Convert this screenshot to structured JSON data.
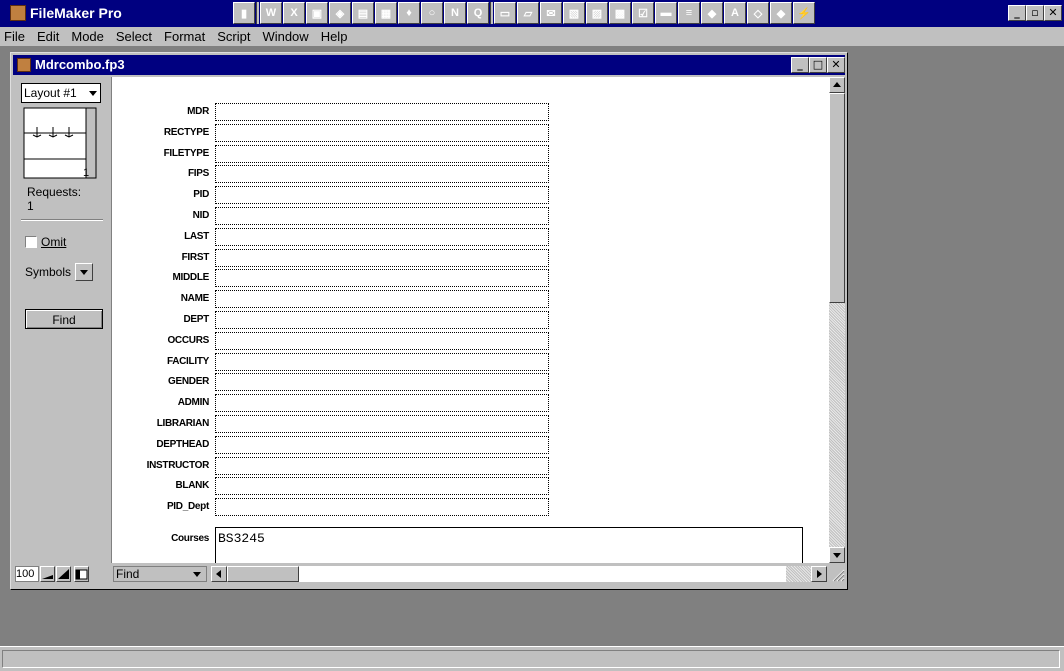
{
  "app": {
    "title": "FileMaker Pro",
    "caption_buttons": [
      "_",
      "▫",
      "✕"
    ]
  },
  "toolbar_tray": [
    {
      "icon": "app-launcher-icon",
      "glyph": "▮"
    },
    {
      "icon": "word-icon",
      "glyph": "W"
    },
    {
      "icon": "excel-icon",
      "glyph": "X"
    },
    {
      "icon": "powerpoint-icon",
      "glyph": "▣"
    },
    {
      "icon": "access-icon",
      "glyph": "◈"
    },
    {
      "icon": "schedule-icon",
      "glyph": "▤"
    },
    {
      "icon": "office-binder-icon",
      "glyph": "▦"
    },
    {
      "icon": "shortcut-bar-icon",
      "glyph": "♦"
    },
    {
      "icon": "circle-icon",
      "glyph": "○"
    },
    {
      "icon": "n-app-icon",
      "glyph": "N"
    },
    {
      "icon": "find-icon",
      "glyph": "Q"
    },
    {
      "icon": "new-document-icon",
      "glyph": "▭"
    },
    {
      "icon": "open-folder-icon",
      "glyph": "▱"
    },
    {
      "icon": "mail-icon",
      "glyph": "✉"
    },
    {
      "icon": "contacts-icon",
      "glyph": "▧"
    },
    {
      "icon": "task-icon",
      "glyph": "▨"
    },
    {
      "icon": "calendar-icon",
      "glyph": "▩"
    },
    {
      "icon": "checklist-icon",
      "glyph": "☑"
    },
    {
      "icon": "card-icon",
      "glyph": "▬"
    },
    {
      "icon": "keyboard-icon",
      "glyph": "≡"
    },
    {
      "icon": "graphics-icon",
      "glyph": "◆"
    },
    {
      "icon": "acrobat-icon",
      "glyph": "A"
    },
    {
      "icon": "paint-icon",
      "glyph": "◇"
    },
    {
      "icon": "gem-icon",
      "glyph": "◆"
    },
    {
      "icon": "wand-icon",
      "glyph": "⚡"
    }
  ],
  "menu": [
    "File",
    "Edit",
    "Mode",
    "Select",
    "Format",
    "Script",
    "Window",
    "Help"
  ],
  "document": {
    "title": "Mdrcombo.fp3",
    "caption_buttons": [
      "_",
      "□",
      "✕"
    ]
  },
  "status_area": {
    "layout_select": "Layout #1",
    "book_page": "1",
    "requests_label": "Requests:",
    "requests_count": "1",
    "omit_label": "Omit",
    "symbols_label": "Symbols",
    "find_button": "Find"
  },
  "fields": [
    {
      "label": "MDR",
      "value": ""
    },
    {
      "label": "RECTYPE",
      "value": ""
    },
    {
      "label": "FILETYPE",
      "value": ""
    },
    {
      "label": "FIPS",
      "value": ""
    },
    {
      "label": "PID",
      "value": ""
    },
    {
      "label": "NID",
      "value": ""
    },
    {
      "label": "LAST",
      "value": ""
    },
    {
      "label": "FIRST",
      "value": ""
    },
    {
      "label": "MIDDLE",
      "value": ""
    },
    {
      "label": "NAME",
      "value": ""
    },
    {
      "label": "DEPT",
      "value": ""
    },
    {
      "label": "OCCURS",
      "value": ""
    },
    {
      "label": "FACILITY",
      "value": ""
    },
    {
      "label": "GENDER",
      "value": ""
    },
    {
      "label": "ADMIN",
      "value": ""
    },
    {
      "label": "LIBRARIAN",
      "value": ""
    },
    {
      "label": "DEPTHEAD",
      "value": ""
    },
    {
      "label": "INSTRUCTOR",
      "value": ""
    },
    {
      "label": "BLANK",
      "value": ""
    },
    {
      "label": "PID_Dept",
      "value": ""
    }
  ],
  "courses": {
    "label": "Courses",
    "value": "BS3245"
  },
  "bottom_bar": {
    "zoom": "100",
    "mode": "Find"
  }
}
